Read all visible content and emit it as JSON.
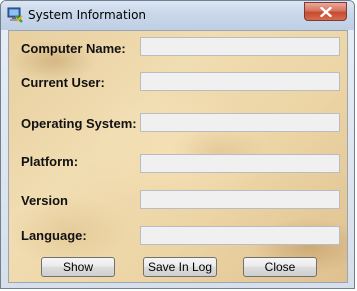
{
  "window": {
    "title": "System Information"
  },
  "fields": [
    {
      "label": "Computer Name:",
      "value": ""
    },
    {
      "label": "Current User:",
      "value": ""
    },
    {
      "label": "Operating System:",
      "value": ""
    },
    {
      "label": "Platform:",
      "value": ""
    },
    {
      "label": "Version",
      "value": ""
    },
    {
      "label": "Language:",
      "value": ""
    }
  ],
  "buttons": {
    "show": "Show",
    "save": "Save In Log",
    "close": "Close"
  }
}
